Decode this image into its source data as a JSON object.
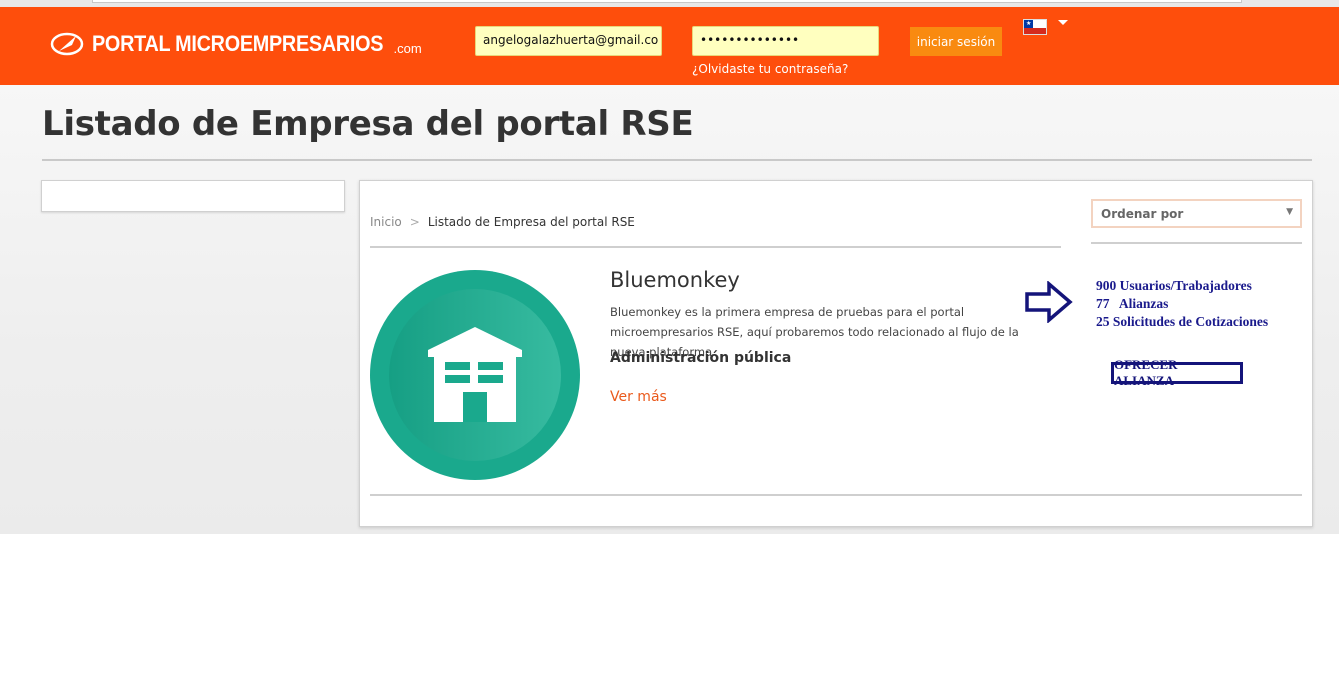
{
  "header": {
    "logo_text": "PORTAL MICROEMPRESARIOS",
    "logo_suffix": ".com",
    "email_value": "angelogalazhuerta@gmail.co",
    "password_value": "••••••••••••••",
    "forgot_link": "¿Olvidaste tu contraseña?",
    "login_button": "iniciar sesión",
    "flag_icon": "chile-flag-icon"
  },
  "page": {
    "title": "Listado de Empresa del portal RSE"
  },
  "breadcrumb": {
    "home": "Inicio",
    "separator": ">",
    "current": "Listado de Empresa del portal RSE"
  },
  "sort": {
    "placeholder": "Ordenar por",
    "caret": "▼"
  },
  "company": {
    "name": "Bluemonkey",
    "description": "Bluemonkey es la primera empresa de pruebas para el portal microempresarios RSE, aquí probaremos todo relacionado al flujo de la nueva plataforma",
    "sector": "Administración pública",
    "more_link": "Ver más",
    "logo_icon": "building-icon",
    "logo_color": "#1aa98d"
  },
  "stats": {
    "users": "900 Usuarios/Trabajadores",
    "alliances": "77   Alianzas",
    "quotes": "25 Solicitudes de Cotizaciones",
    "offer_button": "OFRECER ALIANZA",
    "accent_color": "#1a1a8c"
  },
  "colors": {
    "header_bg": "#fe4e0c",
    "login_btn": "#f98a10",
    "link_orange": "#ea5a1c"
  }
}
